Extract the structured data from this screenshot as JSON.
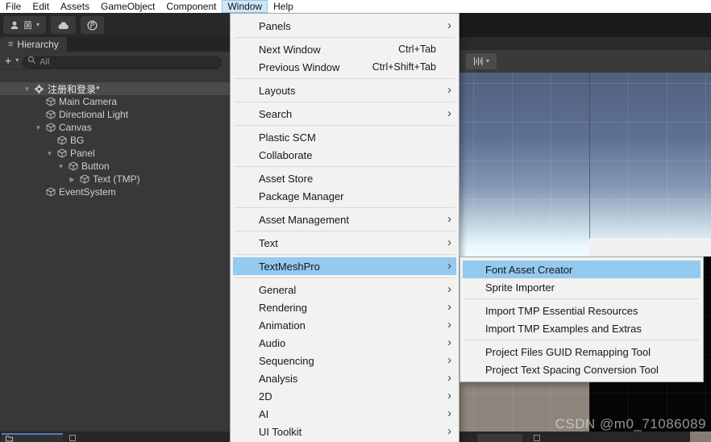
{
  "colors": {
    "menu_highlight": "#94c9f0",
    "menubar_highlight": "#cde8fb",
    "tab_accent": "#4a7fb5"
  },
  "icons": {
    "dropdown": "▾",
    "hamburger": "≡",
    "plus": "+",
    "tree_down": "▼",
    "tree_right": "▶",
    "tree_none": "",
    "submenu_arrow": "›"
  },
  "menubar": {
    "items": [
      {
        "label": "File"
      },
      {
        "label": "Edit"
      },
      {
        "label": "Assets"
      },
      {
        "label": "GameObject"
      },
      {
        "label": "Component"
      },
      {
        "label": "Window",
        "active": true
      },
      {
        "label": "Help"
      }
    ]
  },
  "toolbar": {
    "account_label": "菌"
  },
  "hierarchy": {
    "tab_label": "Hierarchy",
    "search_placeholder": "All",
    "tree": [
      {
        "label": "注册和登录*",
        "level": 0,
        "arrow": "down",
        "icon": "scene",
        "selected": true
      },
      {
        "label": "Main Camera",
        "level": 1,
        "arrow": "none",
        "icon": "cube"
      },
      {
        "label": "Directional Light",
        "level": 1,
        "arrow": "none",
        "icon": "cube"
      },
      {
        "label": "Canvas",
        "level": 1,
        "arrow": "down",
        "icon": "cube"
      },
      {
        "label": "BG",
        "level": 2,
        "arrow": "none",
        "icon": "cube"
      },
      {
        "label": "Panel",
        "level": 2,
        "arrow": "down",
        "icon": "cube"
      },
      {
        "label": "Button",
        "level": 3,
        "arrow": "down",
        "icon": "cube"
      },
      {
        "label": "Text (TMP)",
        "level": 4,
        "arrow": "right",
        "icon": "cube"
      },
      {
        "label": "EventSystem",
        "level": 1,
        "arrow": "none",
        "icon": "cube"
      }
    ]
  },
  "window_menu": {
    "items": [
      {
        "label": "Panels",
        "submenu": true
      },
      {
        "type": "sep"
      },
      {
        "label": "Next Window",
        "shortcut": "Ctrl+Tab"
      },
      {
        "label": "Previous Window",
        "shortcut": "Ctrl+Shift+Tab"
      },
      {
        "type": "sep"
      },
      {
        "label": "Layouts",
        "submenu": true
      },
      {
        "type": "sep"
      },
      {
        "label": "Search",
        "submenu": true
      },
      {
        "type": "sep"
      },
      {
        "label": "Plastic SCM"
      },
      {
        "label": "Collaborate"
      },
      {
        "type": "sep"
      },
      {
        "label": "Asset Store"
      },
      {
        "label": "Package Manager"
      },
      {
        "type": "sep"
      },
      {
        "label": "Asset Management",
        "submenu": true
      },
      {
        "type": "sep"
      },
      {
        "label": "Text",
        "submenu": true
      },
      {
        "type": "sep"
      },
      {
        "label": "TextMeshPro",
        "submenu": true,
        "highlight": true
      },
      {
        "type": "sep"
      },
      {
        "label": "General",
        "submenu": true
      },
      {
        "label": "Rendering",
        "submenu": true
      },
      {
        "label": "Animation",
        "submenu": true
      },
      {
        "label": "Audio",
        "submenu": true
      },
      {
        "label": "Sequencing",
        "submenu": true
      },
      {
        "label": "Analysis",
        "submenu": true
      },
      {
        "label": "2D",
        "submenu": true
      },
      {
        "label": "AI",
        "submenu": true
      },
      {
        "label": "UI Toolkit",
        "submenu": true
      }
    ]
  },
  "tmp_submenu": {
    "items": [
      {
        "label": "Font Asset Creator",
        "highlight": true
      },
      {
        "label": "Sprite Importer"
      },
      {
        "type": "sep"
      },
      {
        "label": "Import TMP Essential Resources"
      },
      {
        "label": "Import TMP Examples and Extras"
      },
      {
        "type": "sep"
      },
      {
        "label": "Project Files GUID Remapping Tool"
      },
      {
        "label": "Project Text Spacing Conversion Tool"
      }
    ]
  },
  "scene": {
    "watermark": "CSDN @m0_71086089"
  }
}
